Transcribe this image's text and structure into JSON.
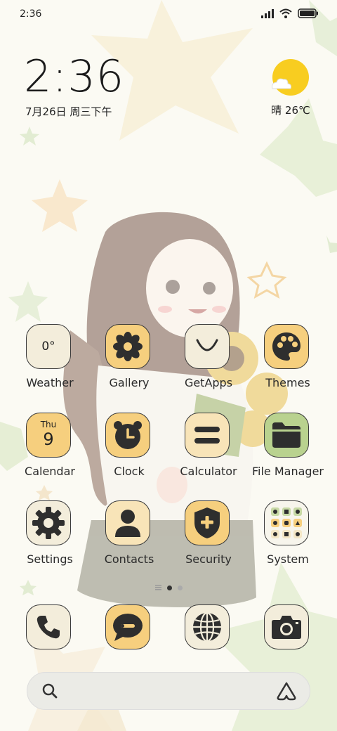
{
  "status_bar": {
    "time": "2:36",
    "icons": [
      "signal-icon",
      "wifi-icon",
      "battery-icon"
    ]
  },
  "clock_widget": {
    "time": "2:36",
    "date": "7月26日 周三下午"
  },
  "weather_widget": {
    "condition": "晴",
    "temperature": "26℃",
    "icon": "sun-cloud-icon"
  },
  "apps": [
    {
      "label": "Weather",
      "icon_text": "0°",
      "icon": "weather-icon"
    },
    {
      "label": "Gallery",
      "icon": "flower-icon"
    },
    {
      "label": "GetApps",
      "icon": "smile-bag-icon"
    },
    {
      "label": "Themes",
      "icon": "palette-icon"
    },
    {
      "label": "Calendar",
      "icon_day": "Thu",
      "icon_date": "9",
      "icon": "calendar-icon"
    },
    {
      "label": "Clock",
      "icon": "alarm-clock-icon"
    },
    {
      "label": "Calculator",
      "icon": "equals-icon"
    },
    {
      "label": "File Manager",
      "icon": "folder-icon"
    },
    {
      "label": "Settings",
      "icon": "gear-icon"
    },
    {
      "label": "Contacts",
      "icon": "person-icon"
    },
    {
      "label": "Security",
      "icon": "shield-plus-icon"
    },
    {
      "label": "System",
      "icon": "folder-grid-icon"
    }
  ],
  "page_indicator": {
    "current": 1,
    "total": 2
  },
  "dock": [
    {
      "name": "Phone",
      "icon": "phone-icon"
    },
    {
      "name": "Messages",
      "icon": "message-icon"
    },
    {
      "name": "Browser",
      "icon": "globe-icon"
    },
    {
      "name": "Camera",
      "icon": "camera-icon"
    }
  ],
  "search_bar": {
    "icon_left": "search-icon",
    "icon_right": "assistant-icon"
  },
  "colors": {
    "cream": "#f3eddb",
    "yellow": "#f6cf7e",
    "green": "#b9d28f",
    "outline": "#3a3a3a"
  }
}
